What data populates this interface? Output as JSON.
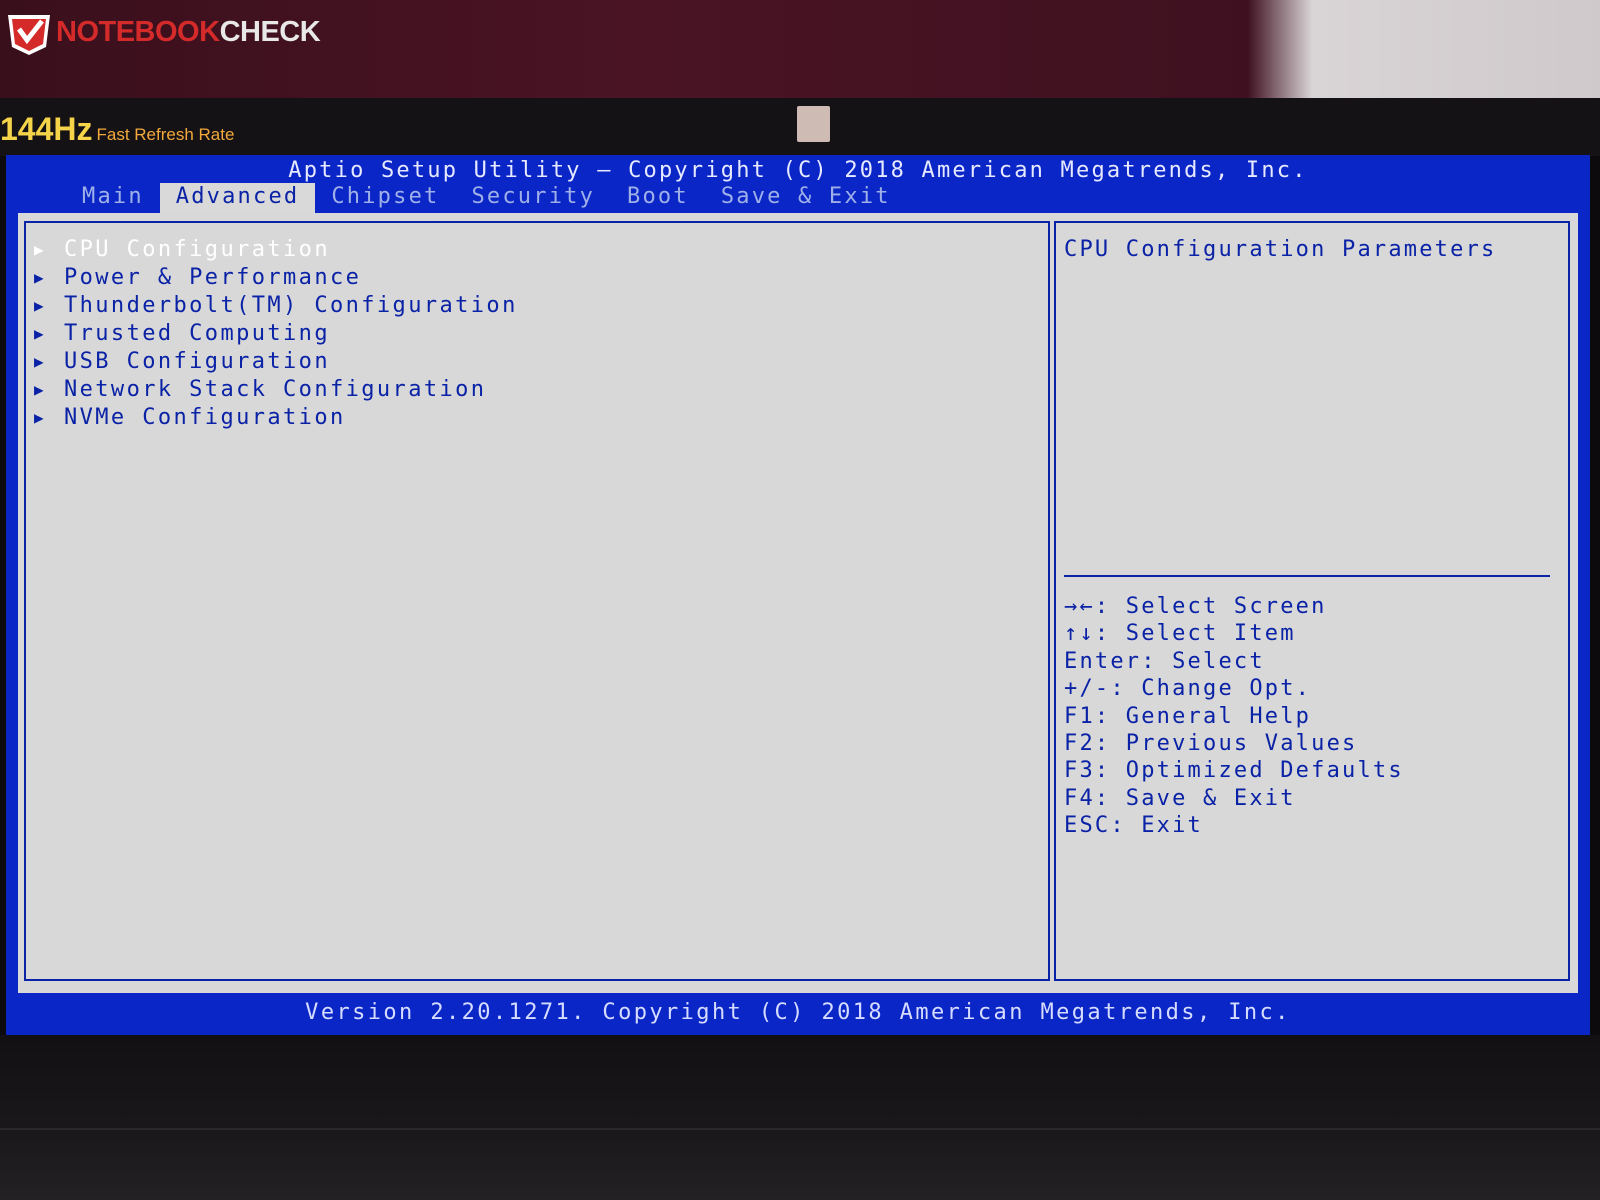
{
  "photo": {
    "watermark": "NOTEBOOKCHECK",
    "watermark_parts": [
      "NOTEBOOK",
      "CHECK"
    ],
    "sticker_hz": "144Hz",
    "sticker_text": "Fast Refresh Rate"
  },
  "bios": {
    "title": "Aptio Setup Utility – Copyright (C) 2018 American Megatrends, Inc.",
    "tabs": [
      {
        "label": "Main",
        "active": false
      },
      {
        "label": "Advanced",
        "active": true
      },
      {
        "label": "Chipset",
        "active": false
      },
      {
        "label": "Security",
        "active": false
      },
      {
        "label": "Boot",
        "active": false
      },
      {
        "label": "Save & Exit",
        "active": false
      }
    ],
    "menu": [
      {
        "label": "CPU Configuration",
        "selected": true
      },
      {
        "label": "Power & Performance",
        "selected": false
      },
      {
        "label": "Thunderbolt(TM) Configuration",
        "selected": false
      },
      {
        "label": "Trusted Computing",
        "selected": false
      },
      {
        "label": "USB Configuration",
        "selected": false
      },
      {
        "label": "Network Stack Configuration",
        "selected": false
      },
      {
        "label": "NVMe Configuration",
        "selected": false
      }
    ],
    "menu_arrow": "▶",
    "help": "CPU Configuration Parameters",
    "keys": [
      "→←: Select Screen",
      "↑↓: Select Item",
      "Enter: Select",
      "+/-: Change Opt.",
      "F1: General Help",
      "F2: Previous Values",
      "F3: Optimized Defaults",
      "F4: Save & Exit",
      "ESC: Exit"
    ],
    "footer": "Version 2.20.1271. Copyright (C) 2018 American Megatrends, Inc."
  },
  "colors": {
    "bios_blue": "#0a26c6",
    "panel_gray": "#d8d8d8",
    "text_blue": "#0a22a6",
    "watermark_red": "#d42a2a",
    "sticker_yellow": "#f5d44a"
  }
}
